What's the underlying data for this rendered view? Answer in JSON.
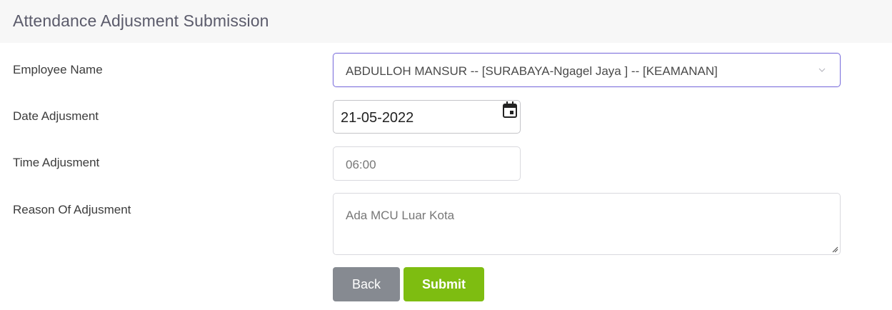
{
  "header": {
    "title": "Attendance Adjusment Submission"
  },
  "form": {
    "employee_name": {
      "label": "Employee Name",
      "value": "ABDULLOH MANSUR -- [SURABAYA-Ngagel Jaya ] -- [KEAMANAN]"
    },
    "date_adjustment": {
      "label": "Date Adjusment",
      "value": "21-05-2022"
    },
    "time_adjustment": {
      "label": "Time Adjusment",
      "value": "06:00"
    },
    "reason": {
      "label": "Reason Of Adjusment",
      "value": "Ada MCU Luar Kota"
    }
  },
  "buttons": {
    "back": "Back",
    "submit": "Submit"
  },
  "icons": {
    "select": "chevron-down-icon",
    "date": "calendar-icon",
    "textarea": "resize-handle-icon"
  },
  "colors": {
    "select_border": "#7b6fdc",
    "back_button": "#868a91",
    "submit_button": "#7ebd11",
    "header_bg": "#f7f7f7"
  }
}
